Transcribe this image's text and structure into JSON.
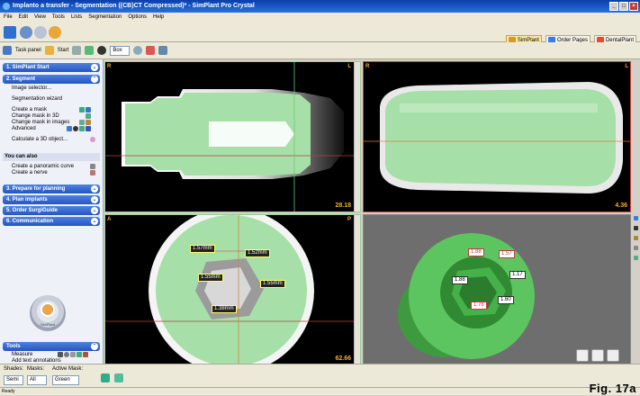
{
  "window": {
    "title": "Implanto a transfer - Segmentation ((CB)CT Compressed)* - SimPlant Pro Crystal",
    "min": "_",
    "max": "□",
    "close": "×"
  },
  "menu": [
    "File",
    "Edit",
    "View",
    "Tools",
    "Lists",
    "Segmentation",
    "Options",
    "Help"
  ],
  "right_tabs": [
    {
      "label": "SimPlant",
      "active": true,
      "color": "#d59a2c"
    },
    {
      "label": "Order Pages",
      "active": false,
      "color": "#3a7be0"
    },
    {
      "label": "DentalPlant",
      "active": false,
      "color": "#e34d32"
    }
  ],
  "toolbar2": {
    "task_panel": "Task panel",
    "start": "Start",
    "box_value": "Box"
  },
  "left_panel": {
    "sections": [
      {
        "label": "1. SimPlant Start"
      },
      {
        "label": "2. Segment"
      },
      {
        "label": "3. Prepare for planning"
      },
      {
        "label": "4. Plan implants"
      },
      {
        "label": "5. Order SurgiGuide"
      },
      {
        "label": "6. Communication"
      }
    ],
    "segment_items": [
      "Image selector...",
      "Segmentation wizard",
      "Create a mask",
      "Change mask in 3D",
      "Change mask in images",
      "Advanced",
      "Calculate a 3D object..."
    ],
    "you_can_also": "You can also",
    "also_items": [
      "Create a panoramic curve",
      "Create a nerve"
    ],
    "logo_text": "SimPlant",
    "tools": {
      "title": "Tools",
      "items": [
        "Measure",
        "Add text annotations"
      ]
    }
  },
  "viewports": {
    "top_left": {
      "corner_left": "R",
      "corner_right": "L",
      "scale": "28.18"
    },
    "top_right": {
      "corner_left": "R",
      "corner_right": "L",
      "scale": "4.36"
    },
    "bottom_left": {
      "corner_left": "A",
      "corner_right": "P",
      "scale": "62.66",
      "measurements": [
        "1.57mm",
        "1.52mm",
        "1.55mm",
        "1.55mm",
        "1.38mm"
      ]
    },
    "bottom_right": {
      "measurements": [
        "1.88",
        "1.57",
        "1.17",
        "1.88",
        "1.78",
        "1.60"
      ]
    }
  },
  "bottom_bar": {
    "shades_label": "Shades:",
    "masks_label": "Masks:",
    "active_mask_label": "Active Mask:",
    "shades_value": "Semi",
    "masks_value": "All",
    "active_mask_value": "Green"
  },
  "status": "Ready",
  "figure_label": "Fig. 17a"
}
